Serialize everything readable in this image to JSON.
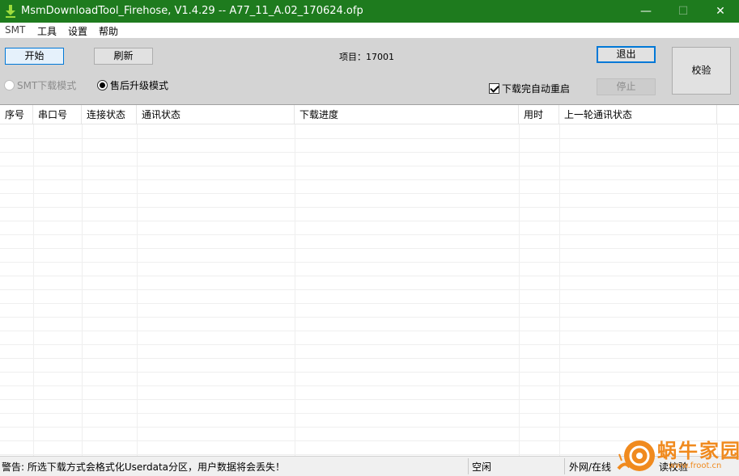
{
  "window": {
    "title": "MsmDownloadTool_Firehose, V1.4.29 -- A77_11_A.02_170624.ofp",
    "minimize_glyph": "—",
    "maximize_glyph": "☐",
    "close_glyph": "✕"
  },
  "menu": [
    "SMT",
    "工具",
    "设置",
    "帮助"
  ],
  "toolbar": {
    "start_label": "开始",
    "refresh_label": "刷新",
    "project_label": "项目：",
    "project_value": "17001",
    "exit_label": "退出",
    "stop_label": "停止",
    "verify_label": "校验",
    "mode_smt_label": "SMT下载模式",
    "mode_smt_selected": false,
    "mode_aftersale_label": "售后升级模式",
    "mode_aftersale_selected": true,
    "auto_reboot_label": "下载完自动重启",
    "auto_reboot_checked": true
  },
  "table": {
    "columns": [
      "序号",
      "串口号",
      "连接状态",
      "通讯状态",
      "下载进度",
      "用时",
      "上一轮通讯状态"
    ],
    "rows": []
  },
  "status": {
    "warning": "警告: 所选下载方式会格式化Userdata分区，用户数据将会丢失！",
    "state": "空闲",
    "network": "外网/在线",
    "verify": "读校验"
  },
  "watermark": {
    "name": "蜗牛家园",
    "url": "www.froot.cn"
  },
  "colors": {
    "titlebar": "#1e7b1e",
    "panel": "#d4d4d4",
    "accent": "#0078d7",
    "watermark": "#f08a1e"
  }
}
